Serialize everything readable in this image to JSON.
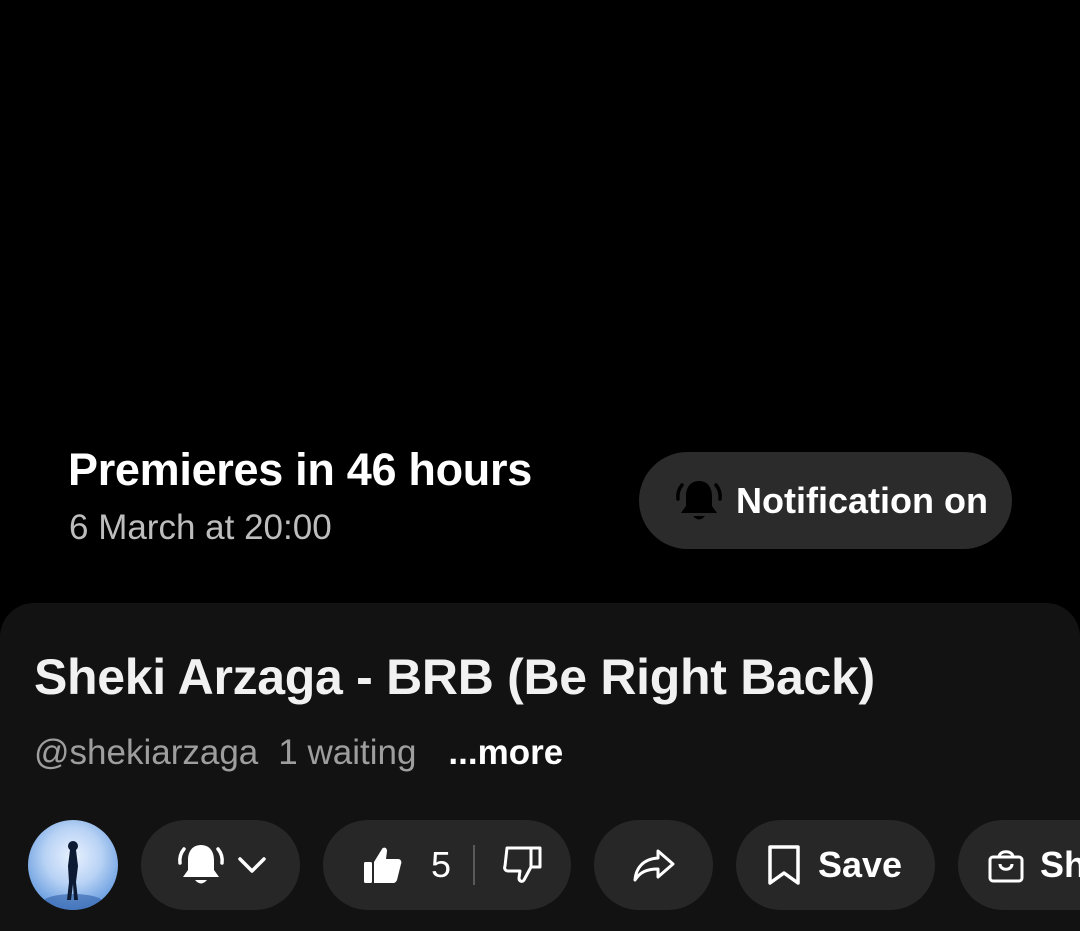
{
  "premiere": {
    "title": "Premieres in 46 hours",
    "date": "6 March at 20:00",
    "notification_button": {
      "label": "Notification on",
      "icon": "bell-ringing-icon"
    }
  },
  "video": {
    "title": "Sheki Arzaga - BRB (Be Right Back)",
    "channel_handle": "@shekiarzaga",
    "waiting": "1 waiting",
    "more_label": "...more"
  },
  "actions": {
    "subscribe_bell": {
      "icon": "bell-ringing-icon",
      "dropdown_icon": "chevron-down-icon"
    },
    "like": {
      "icon": "thumbs-up-icon",
      "count": "5"
    },
    "dislike": {
      "icon": "thumbs-down-icon"
    },
    "share": {
      "icon": "share-icon"
    },
    "save": {
      "icon": "bookmark-icon",
      "label": "Save"
    },
    "shop": {
      "icon": "shopping-bag-icon",
      "label": "Sh"
    }
  },
  "colors": {
    "background": "#000000",
    "sheet": "#121212",
    "pill": "#272727",
    "notification_pill": "#2b2b2b",
    "secondary_text": "#9e9e9e"
  }
}
